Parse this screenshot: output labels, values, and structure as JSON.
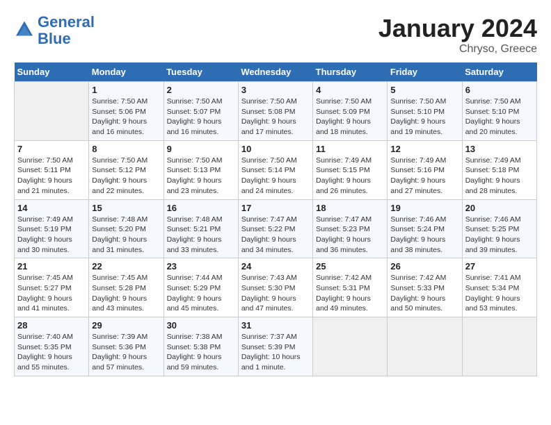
{
  "header": {
    "logo_line1": "General",
    "logo_line2": "Blue",
    "month_title": "January 2024",
    "location": "Chryso, Greece"
  },
  "weekdays": [
    "Sunday",
    "Monday",
    "Tuesday",
    "Wednesday",
    "Thursday",
    "Friday",
    "Saturday"
  ],
  "weeks": [
    [
      {
        "day": "",
        "sunrise": "",
        "sunset": "",
        "daylight": ""
      },
      {
        "day": "1",
        "sunrise": "Sunrise: 7:50 AM",
        "sunset": "Sunset: 5:06 PM",
        "daylight": "Daylight: 9 hours and 16 minutes."
      },
      {
        "day": "2",
        "sunrise": "Sunrise: 7:50 AM",
        "sunset": "Sunset: 5:07 PM",
        "daylight": "Daylight: 9 hours and 16 minutes."
      },
      {
        "day": "3",
        "sunrise": "Sunrise: 7:50 AM",
        "sunset": "Sunset: 5:08 PM",
        "daylight": "Daylight: 9 hours and 17 minutes."
      },
      {
        "day": "4",
        "sunrise": "Sunrise: 7:50 AM",
        "sunset": "Sunset: 5:09 PM",
        "daylight": "Daylight: 9 hours and 18 minutes."
      },
      {
        "day": "5",
        "sunrise": "Sunrise: 7:50 AM",
        "sunset": "Sunset: 5:10 PM",
        "daylight": "Daylight: 9 hours and 19 minutes."
      },
      {
        "day": "6",
        "sunrise": "Sunrise: 7:50 AM",
        "sunset": "Sunset: 5:10 PM",
        "daylight": "Daylight: 9 hours and 20 minutes."
      }
    ],
    [
      {
        "day": "7",
        "sunrise": "Sunrise: 7:50 AM",
        "sunset": "Sunset: 5:11 PM",
        "daylight": "Daylight: 9 hours and 21 minutes."
      },
      {
        "day": "8",
        "sunrise": "Sunrise: 7:50 AM",
        "sunset": "Sunset: 5:12 PM",
        "daylight": "Daylight: 9 hours and 22 minutes."
      },
      {
        "day": "9",
        "sunrise": "Sunrise: 7:50 AM",
        "sunset": "Sunset: 5:13 PM",
        "daylight": "Daylight: 9 hours and 23 minutes."
      },
      {
        "day": "10",
        "sunrise": "Sunrise: 7:50 AM",
        "sunset": "Sunset: 5:14 PM",
        "daylight": "Daylight: 9 hours and 24 minutes."
      },
      {
        "day": "11",
        "sunrise": "Sunrise: 7:49 AM",
        "sunset": "Sunset: 5:15 PM",
        "daylight": "Daylight: 9 hours and 26 minutes."
      },
      {
        "day": "12",
        "sunrise": "Sunrise: 7:49 AM",
        "sunset": "Sunset: 5:16 PM",
        "daylight": "Daylight: 9 hours and 27 minutes."
      },
      {
        "day": "13",
        "sunrise": "Sunrise: 7:49 AM",
        "sunset": "Sunset: 5:18 PM",
        "daylight": "Daylight: 9 hours and 28 minutes."
      }
    ],
    [
      {
        "day": "14",
        "sunrise": "Sunrise: 7:49 AM",
        "sunset": "Sunset: 5:19 PM",
        "daylight": "Daylight: 9 hours and 30 minutes."
      },
      {
        "day": "15",
        "sunrise": "Sunrise: 7:48 AM",
        "sunset": "Sunset: 5:20 PM",
        "daylight": "Daylight: 9 hours and 31 minutes."
      },
      {
        "day": "16",
        "sunrise": "Sunrise: 7:48 AM",
        "sunset": "Sunset: 5:21 PM",
        "daylight": "Daylight: 9 hours and 33 minutes."
      },
      {
        "day": "17",
        "sunrise": "Sunrise: 7:47 AM",
        "sunset": "Sunset: 5:22 PM",
        "daylight": "Daylight: 9 hours and 34 minutes."
      },
      {
        "day": "18",
        "sunrise": "Sunrise: 7:47 AM",
        "sunset": "Sunset: 5:23 PM",
        "daylight": "Daylight: 9 hours and 36 minutes."
      },
      {
        "day": "19",
        "sunrise": "Sunrise: 7:46 AM",
        "sunset": "Sunset: 5:24 PM",
        "daylight": "Daylight: 9 hours and 38 minutes."
      },
      {
        "day": "20",
        "sunrise": "Sunrise: 7:46 AM",
        "sunset": "Sunset: 5:25 PM",
        "daylight": "Daylight: 9 hours and 39 minutes."
      }
    ],
    [
      {
        "day": "21",
        "sunrise": "Sunrise: 7:45 AM",
        "sunset": "Sunset: 5:27 PM",
        "daylight": "Daylight: 9 hours and 41 minutes."
      },
      {
        "day": "22",
        "sunrise": "Sunrise: 7:45 AM",
        "sunset": "Sunset: 5:28 PM",
        "daylight": "Daylight: 9 hours and 43 minutes."
      },
      {
        "day": "23",
        "sunrise": "Sunrise: 7:44 AM",
        "sunset": "Sunset: 5:29 PM",
        "daylight": "Daylight: 9 hours and 45 minutes."
      },
      {
        "day": "24",
        "sunrise": "Sunrise: 7:43 AM",
        "sunset": "Sunset: 5:30 PM",
        "daylight": "Daylight: 9 hours and 47 minutes."
      },
      {
        "day": "25",
        "sunrise": "Sunrise: 7:42 AM",
        "sunset": "Sunset: 5:31 PM",
        "daylight": "Daylight: 9 hours and 49 minutes."
      },
      {
        "day": "26",
        "sunrise": "Sunrise: 7:42 AM",
        "sunset": "Sunset: 5:33 PM",
        "daylight": "Daylight: 9 hours and 50 minutes."
      },
      {
        "day": "27",
        "sunrise": "Sunrise: 7:41 AM",
        "sunset": "Sunset: 5:34 PM",
        "daylight": "Daylight: 9 hours and 53 minutes."
      }
    ],
    [
      {
        "day": "28",
        "sunrise": "Sunrise: 7:40 AM",
        "sunset": "Sunset: 5:35 PM",
        "daylight": "Daylight: 9 hours and 55 minutes."
      },
      {
        "day": "29",
        "sunrise": "Sunrise: 7:39 AM",
        "sunset": "Sunset: 5:36 PM",
        "daylight": "Daylight: 9 hours and 57 minutes."
      },
      {
        "day": "30",
        "sunrise": "Sunrise: 7:38 AM",
        "sunset": "Sunset: 5:38 PM",
        "daylight": "Daylight: 9 hours and 59 minutes."
      },
      {
        "day": "31",
        "sunrise": "Sunrise: 7:37 AM",
        "sunset": "Sunset: 5:39 PM",
        "daylight": "Daylight: 10 hours and 1 minute."
      },
      {
        "day": "",
        "sunrise": "",
        "sunset": "",
        "daylight": ""
      },
      {
        "day": "",
        "sunrise": "",
        "sunset": "",
        "daylight": ""
      },
      {
        "day": "",
        "sunrise": "",
        "sunset": "",
        "daylight": ""
      }
    ]
  ]
}
